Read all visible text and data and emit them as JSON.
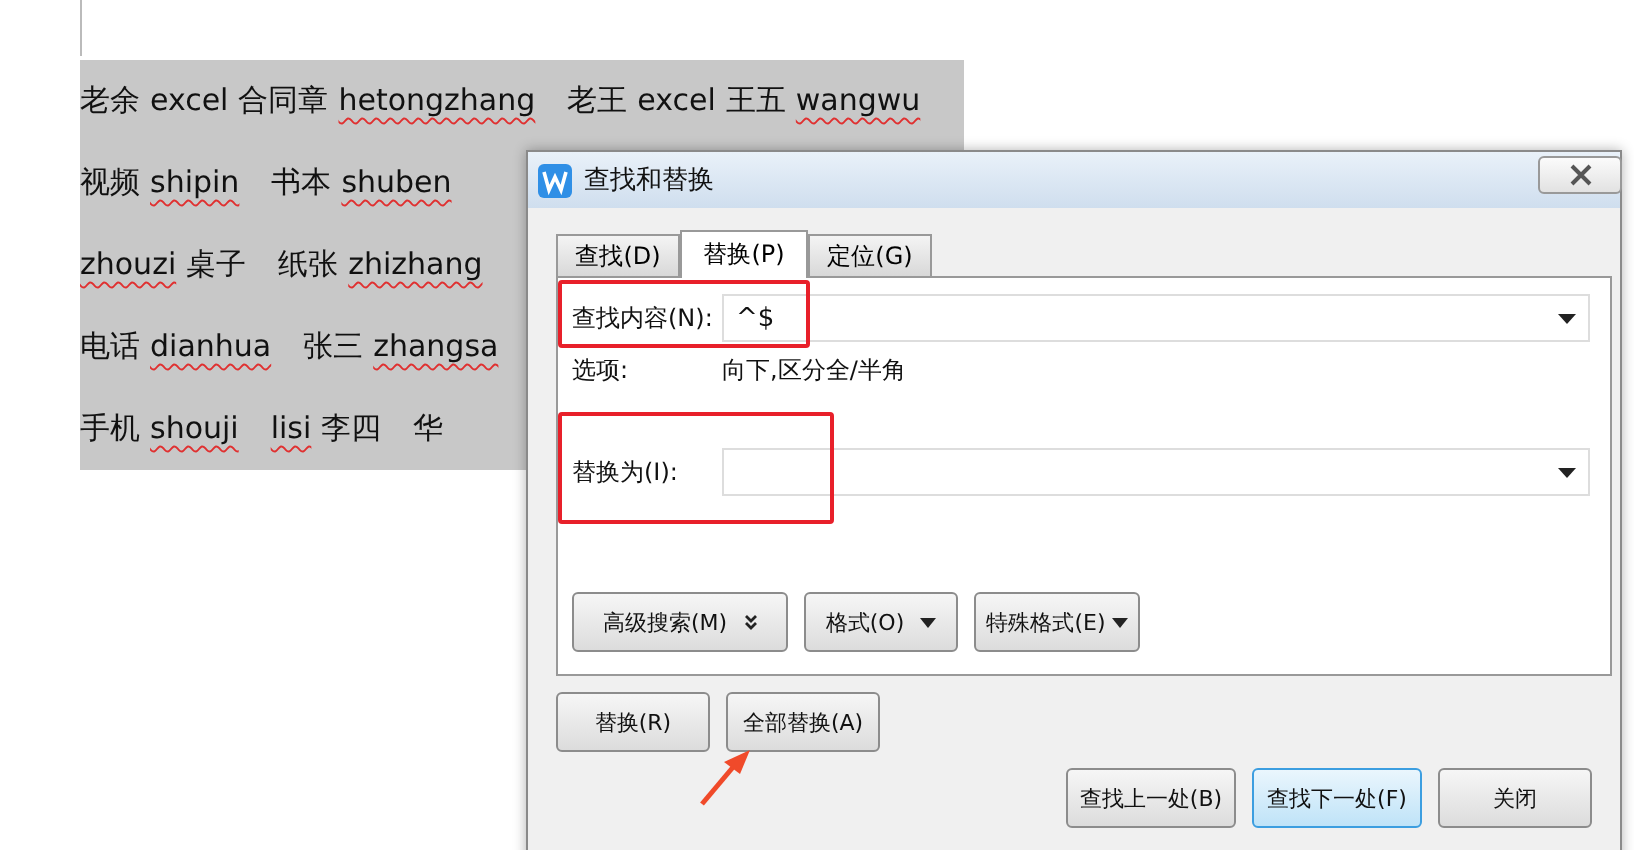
{
  "document": {
    "selected": true,
    "lines": [
      {
        "groups": [
          [
            {
              "text": "老余",
              "misspelled": false
            },
            {
              "text": "excel",
              "misspelled": false
            },
            {
              "text": "合同章",
              "misspelled": false
            },
            {
              "text": "hetongzhang",
              "misspelled": true
            }
          ],
          [
            {
              "text": "老王",
              "misspelled": false
            },
            {
              "text": "excel",
              "misspelled": false
            },
            {
              "text": "王五",
              "misspelled": false
            },
            {
              "text": "wangwu",
              "misspelled": true
            }
          ]
        ]
      },
      {
        "groups": [
          [
            {
              "text": "视频",
              "misspelled": false
            },
            {
              "text": "shipin",
              "misspelled": true
            }
          ],
          [
            {
              "text": "书本",
              "misspelled": false
            },
            {
              "text": "shuben",
              "misspelled": true
            }
          ]
        ]
      },
      {
        "groups": [
          [
            {
              "text": "zhouzi",
              "misspelled": true
            },
            {
              "text": "桌子",
              "misspelled": false
            }
          ],
          [
            {
              "text": "纸张",
              "misspelled": false
            },
            {
              "text": "zhizhang",
              "misspelled": true
            }
          ]
        ]
      },
      {
        "groups": [
          [
            {
              "text": "电话",
              "misspelled": false
            },
            {
              "text": "dianhua",
              "misspelled": true
            }
          ],
          [
            {
              "text": "张三",
              "misspelled": false
            },
            {
              "text": "zhangsa",
              "misspelled": true
            }
          ]
        ]
      },
      {
        "groups": [
          [
            {
              "text": "手机",
              "misspelled": false
            },
            {
              "text": "shouji",
              "misspelled": true
            }
          ],
          [
            {
              "text": "lisi",
              "misspelled": true
            },
            {
              "text": "李四",
              "misspelled": false
            }
          ],
          [
            {
              "text": "华",
              "misspelled": false
            }
          ]
        ]
      }
    ]
  },
  "dialog": {
    "title": "查找和替换",
    "tabs": [
      {
        "label": "查找(D)",
        "selected": false
      },
      {
        "label": "替换(P)",
        "selected": true
      },
      {
        "label": "定位(G)",
        "selected": false
      }
    ],
    "find": {
      "label": "查找内容(N):",
      "value": "^$",
      "highlighted": true
    },
    "options": {
      "label": "选项:",
      "value": "向下,区分全/半角"
    },
    "replace": {
      "label": "替换为(I):",
      "highlighted": true
    },
    "option_buttons": [
      {
        "label": "高级搜索(M)",
        "kind": "expand"
      },
      {
        "label": "格式(O)",
        "kind": "dropdown"
      },
      {
        "label": "特殊格式(E)",
        "kind": "dropdown"
      }
    ],
    "replace_buttons": [
      {
        "label": "替换(R)",
        "focused": false
      },
      {
        "label": "全部替换(A)",
        "focused": false
      }
    ],
    "nav_buttons": [
      {
        "label": "查找上一处(B)",
        "focused": false
      },
      {
        "label": "查找下一处(F)",
        "focused": true
      },
      {
        "label": "关闭",
        "focused": false
      }
    ]
  }
}
